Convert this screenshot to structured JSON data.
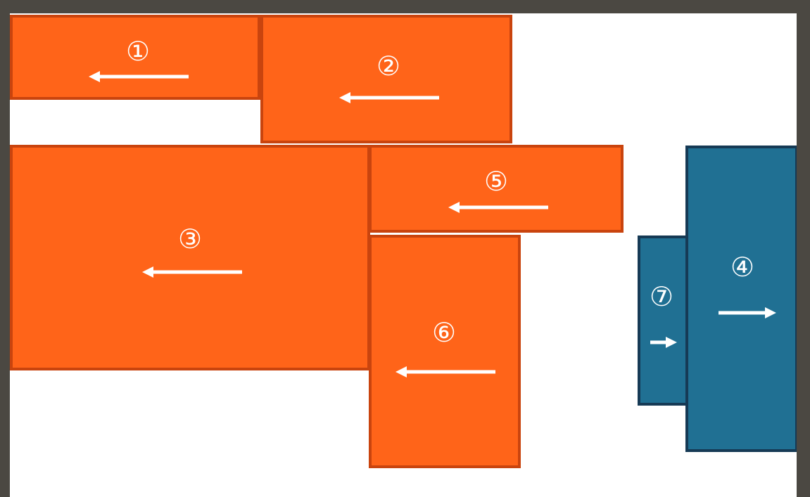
{
  "colors": {
    "frame": "#4b4842",
    "background": "#ffffff",
    "left_block_fill": "#ff6419",
    "left_block_border": "#c9440e",
    "right_block_fill": "#207093",
    "right_block_border": "#163a55",
    "arrow": "#ffffff"
  },
  "blocks": [
    {
      "label": "①",
      "direction": "left",
      "color_group": "orange"
    },
    {
      "label": "②",
      "direction": "left",
      "color_group": "orange"
    },
    {
      "label": "③",
      "direction": "left",
      "color_group": "orange"
    },
    {
      "label": "④",
      "direction": "right",
      "color_group": "blue"
    },
    {
      "label": "⑤",
      "direction": "left",
      "color_group": "orange"
    },
    {
      "label": "⑥",
      "direction": "left",
      "color_group": "orange"
    },
    {
      "label": "⑦",
      "direction": "right",
      "color_group": "blue"
    }
  ]
}
